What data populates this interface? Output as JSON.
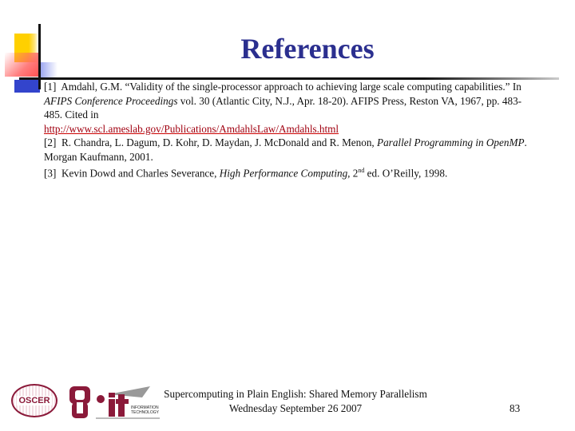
{
  "title": "References",
  "references": [
    {
      "num": "[1]",
      "pre": "Amdahl, G.M. “Validity of the single-processor approach to achieving large scale computing capabilities.” In ",
      "italic": "AFIPS Conference Proceedings",
      "post": " vol. 30 (Atlantic City, N.J., Apr. 18-20). AFIPS Press, Reston VA, 1967, pp. 483-485. Cited in",
      "url": "http://www.scl.ameslab.gov/Publications/AmdahlsLaw/Amdahls.html"
    },
    {
      "num": "[2]",
      "pre": "R. Chandra, L. Dagum, D. Kohr, D. Maydan, J. McDonald and R. Menon, ",
      "italic": "Parallel Programming in OpenMP",
      "post": ". Morgan Kaufmann, 2001."
    },
    {
      "num": "[3]",
      "pre": "Kevin Dowd and Charles Severance, ",
      "italic": "High Performance Computing,",
      "edition": " 2",
      "edition_sup": "nd",
      "post": " ed.  O’Reilly, 1998."
    }
  ],
  "footer": {
    "line1": "Supercomputing in Plain English: Shared Memory Parallelism",
    "line2": "Wednesday September 26 2007",
    "page_number": "83",
    "logos": {
      "oscer": "OSCER",
      "ou": "OU",
      "it": "it",
      "it_caption1": "INFORMATION",
      "it_caption2": "TECHNOLOGY"
    }
  }
}
